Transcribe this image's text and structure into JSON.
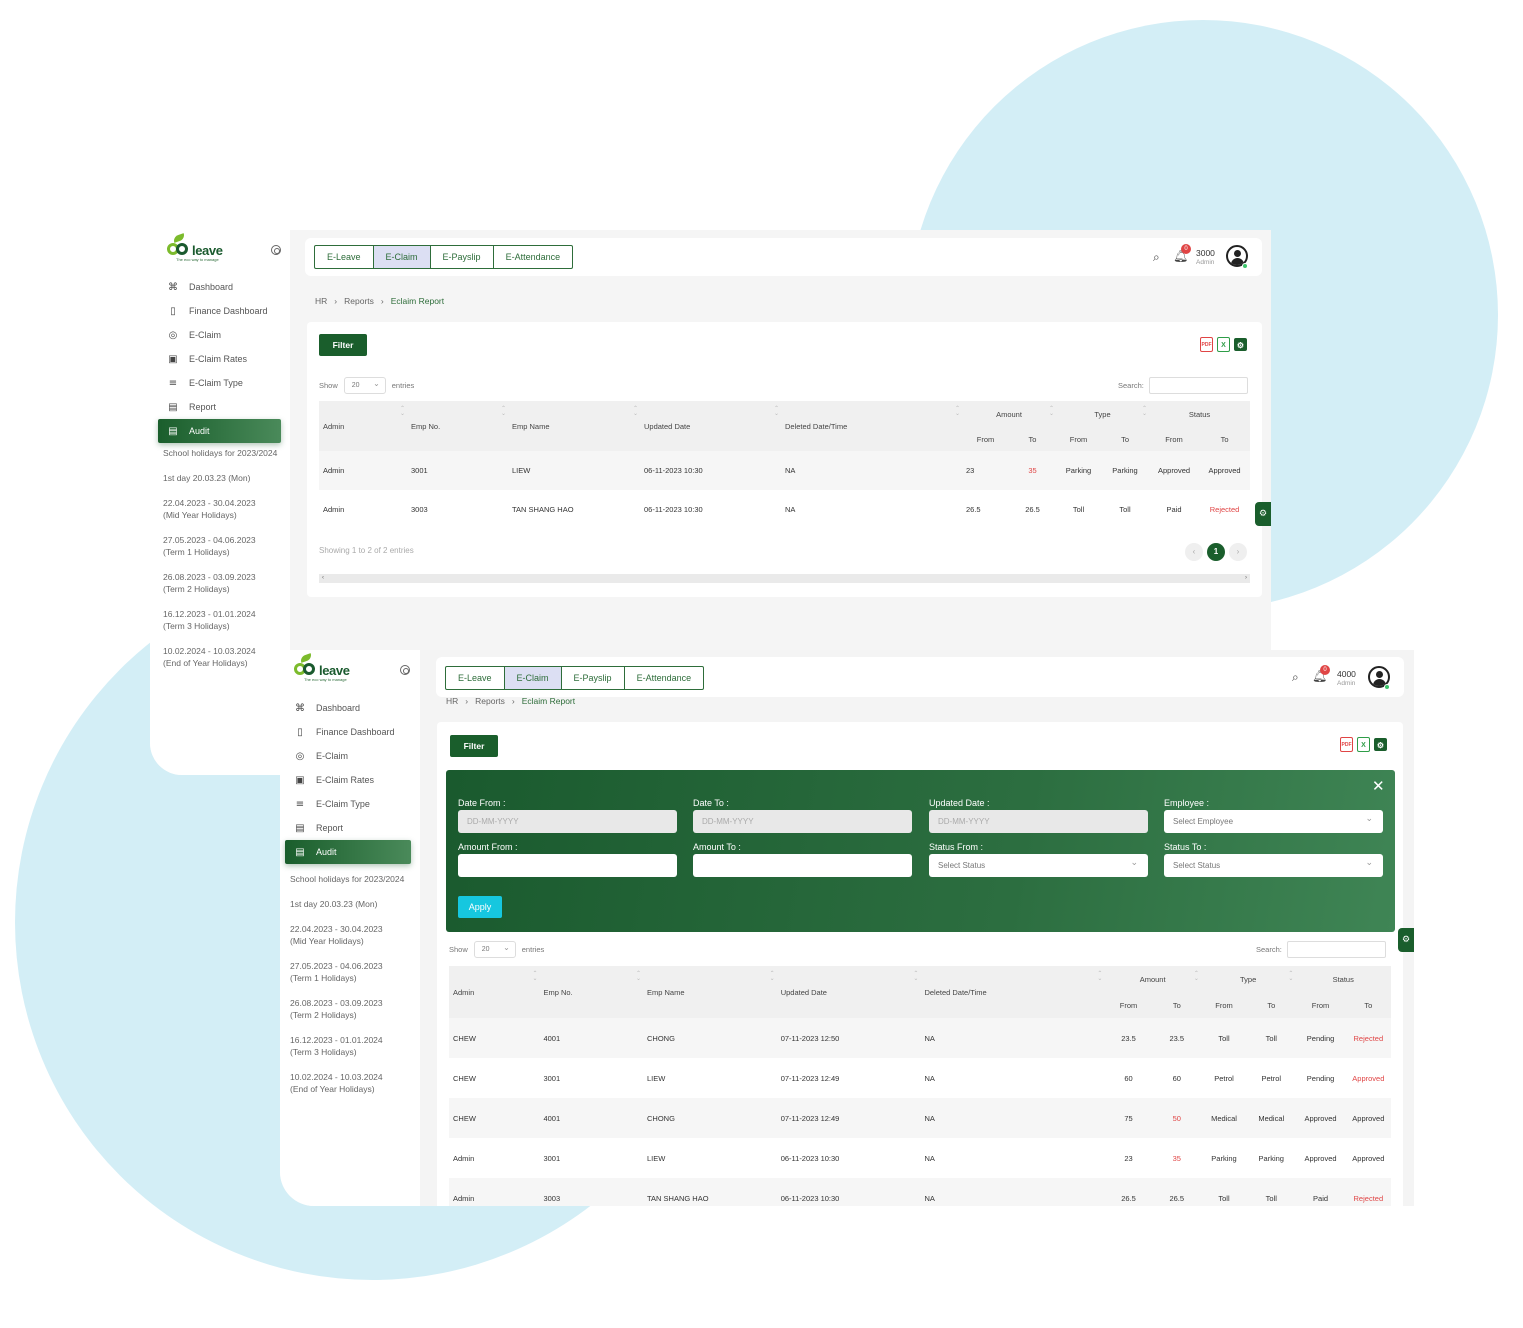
{
  "brand": {
    "word": "leave",
    "tagline": "The eco way to manage"
  },
  "modules": [
    "E-Leave",
    "E-Claim",
    "E-Payslip",
    "E-Attendance"
  ],
  "nav": [
    {
      "label": "Dashboard",
      "icon": "command-icon"
    },
    {
      "label": "Finance Dashboard",
      "icon": "clipboard-icon"
    },
    {
      "label": "E-Claim",
      "icon": "aperture-icon"
    },
    {
      "label": "E-Claim Rates",
      "icon": "briefcase-icon"
    },
    {
      "label": "E-Claim Type",
      "icon": "list-icon"
    },
    {
      "label": "Report",
      "icon": "document-icon"
    },
    {
      "label": "Audit",
      "icon": "document-icon"
    }
  ],
  "holidays": {
    "title": "School holidays for 2023/2024",
    "first_day": "1st day 20.03.23 (Mon)",
    "items": [
      {
        "range": "22.04.2023 - 30.04.2023",
        "name": "(Mid Year Holidays)"
      },
      {
        "range": "27.05.2023 - 04.06.2023",
        "name": "(Term 1 Holidays)"
      },
      {
        "range": "26.08.2023 - 03.09.2023",
        "name": "(Term 2 Holidays)"
      },
      {
        "range": "16.12.2023 - 01.01.2024",
        "name": "(Term 3 Holidays)"
      },
      {
        "range": "10.02.2024 - 10.03.2024",
        "name": "(End of Year Holidays)"
      }
    ]
  },
  "breadcrumb": [
    "HR",
    "Reports",
    "Eclaim Report"
  ],
  "filter_label": "Filter",
  "show_label": "Show",
  "entries_label": "entries",
  "page_size": "20",
  "search_label": "Search:",
  "export": {
    "pdf": "PDF",
    "xls": "X"
  },
  "table": {
    "headers": {
      "admin": "Admin",
      "emp_no": "Emp No.",
      "emp_name": "Emp Name",
      "updated": "Updated Date",
      "deleted": "Deleted Date/Time",
      "amount": "Amount",
      "type": "Type",
      "status": "Status",
      "from": "From",
      "to": "To"
    }
  },
  "window1": {
    "user_id": "3000",
    "user_role": "Admin",
    "notifications": "0",
    "rows": [
      {
        "admin": "Admin",
        "emp_no": "3001",
        "emp_name": "LIEW",
        "updated": "06-11-2023 10:30",
        "deleted": "NA",
        "amt_from": "23",
        "amt_to": "35",
        "type_from": "Parking",
        "type_to": "Parking",
        "status_from": "Approved",
        "status_to": "Approved"
      },
      {
        "admin": "Admin",
        "emp_no": "3003",
        "emp_name": "TAN SHANG HAO",
        "updated": "06-11-2023 10:30",
        "deleted": "NA",
        "amt_from": "26.5",
        "amt_to": "26.5",
        "type_from": "Toll",
        "type_to": "Toll",
        "status_from": "Paid",
        "status_to": "Rejected"
      }
    ],
    "showing": "Showing 1 to 2 of 2 entries",
    "current_page": "1"
  },
  "window2": {
    "user_id": "4000",
    "user_role": "Admin",
    "notifications": "0",
    "filters": {
      "date_from": {
        "label": "Date From :",
        "placeholder": "DD-MM-YYYY"
      },
      "date_to": {
        "label": "Date To :",
        "placeholder": "DD-MM-YYYY"
      },
      "updated_date": {
        "label": "Updated Date :",
        "placeholder": "DD-MM-YYYY"
      },
      "employee": {
        "label": "Employee :",
        "placeholder": "Select Employee"
      },
      "amount_from": {
        "label": "Amount From :",
        "value": ""
      },
      "amount_to": {
        "label": "Amount To :",
        "value": ""
      },
      "status_from": {
        "label": "Status From :",
        "placeholder": "Select Status"
      },
      "status_to": {
        "label": "Status To :",
        "placeholder": "Select Status"
      },
      "apply": "Apply"
    },
    "rows": [
      {
        "admin": "CHEW",
        "emp_no": "4001",
        "emp_name": "CHONG",
        "updated": "07-11-2023 12:50",
        "deleted": "NA",
        "amt_from": "23.5",
        "amt_to": "23.5",
        "type_from": "Toll",
        "type_to": "Toll",
        "status_from": "Pending",
        "status_to": "Rejected"
      },
      {
        "admin": "CHEW",
        "emp_no": "3001",
        "emp_name": "LIEW",
        "updated": "07-11-2023 12:49",
        "deleted": "NA",
        "amt_from": "60",
        "amt_to": "60",
        "type_from": "Petrol",
        "type_to": "Petrol",
        "status_from": "Pending",
        "status_to": "Approved"
      },
      {
        "admin": "CHEW",
        "emp_no": "4001",
        "emp_name": "CHONG",
        "updated": "07-11-2023 12:49",
        "deleted": "NA",
        "amt_from": "75",
        "amt_to": "50",
        "type_from": "Medical",
        "type_to": "Medical",
        "status_from": "Approved",
        "status_to": "Approved"
      },
      {
        "admin": "Admin",
        "emp_no": "3001",
        "emp_name": "LIEW",
        "updated": "06-11-2023 10:30",
        "deleted": "NA",
        "amt_from": "23",
        "amt_to": "35",
        "type_from": "Parking",
        "type_to": "Parking",
        "status_from": "Approved",
        "status_to": "Approved"
      },
      {
        "admin": "Admin",
        "emp_no": "3003",
        "emp_name": "TAN SHANG HAO",
        "updated": "06-11-2023 10:30",
        "deleted": "NA",
        "amt_from": "26.5",
        "amt_to": "26.5",
        "type_from": "Toll",
        "type_to": "Toll",
        "status_from": "Paid",
        "status_to": "Rejected"
      }
    ]
  },
  "colors": {
    "brand_green": "#1a5e2c",
    "accent_lilac": "#dcdff3",
    "danger": "#e04545",
    "apply_cyan": "#16c7df",
    "backdrop": "#d3eef6"
  }
}
